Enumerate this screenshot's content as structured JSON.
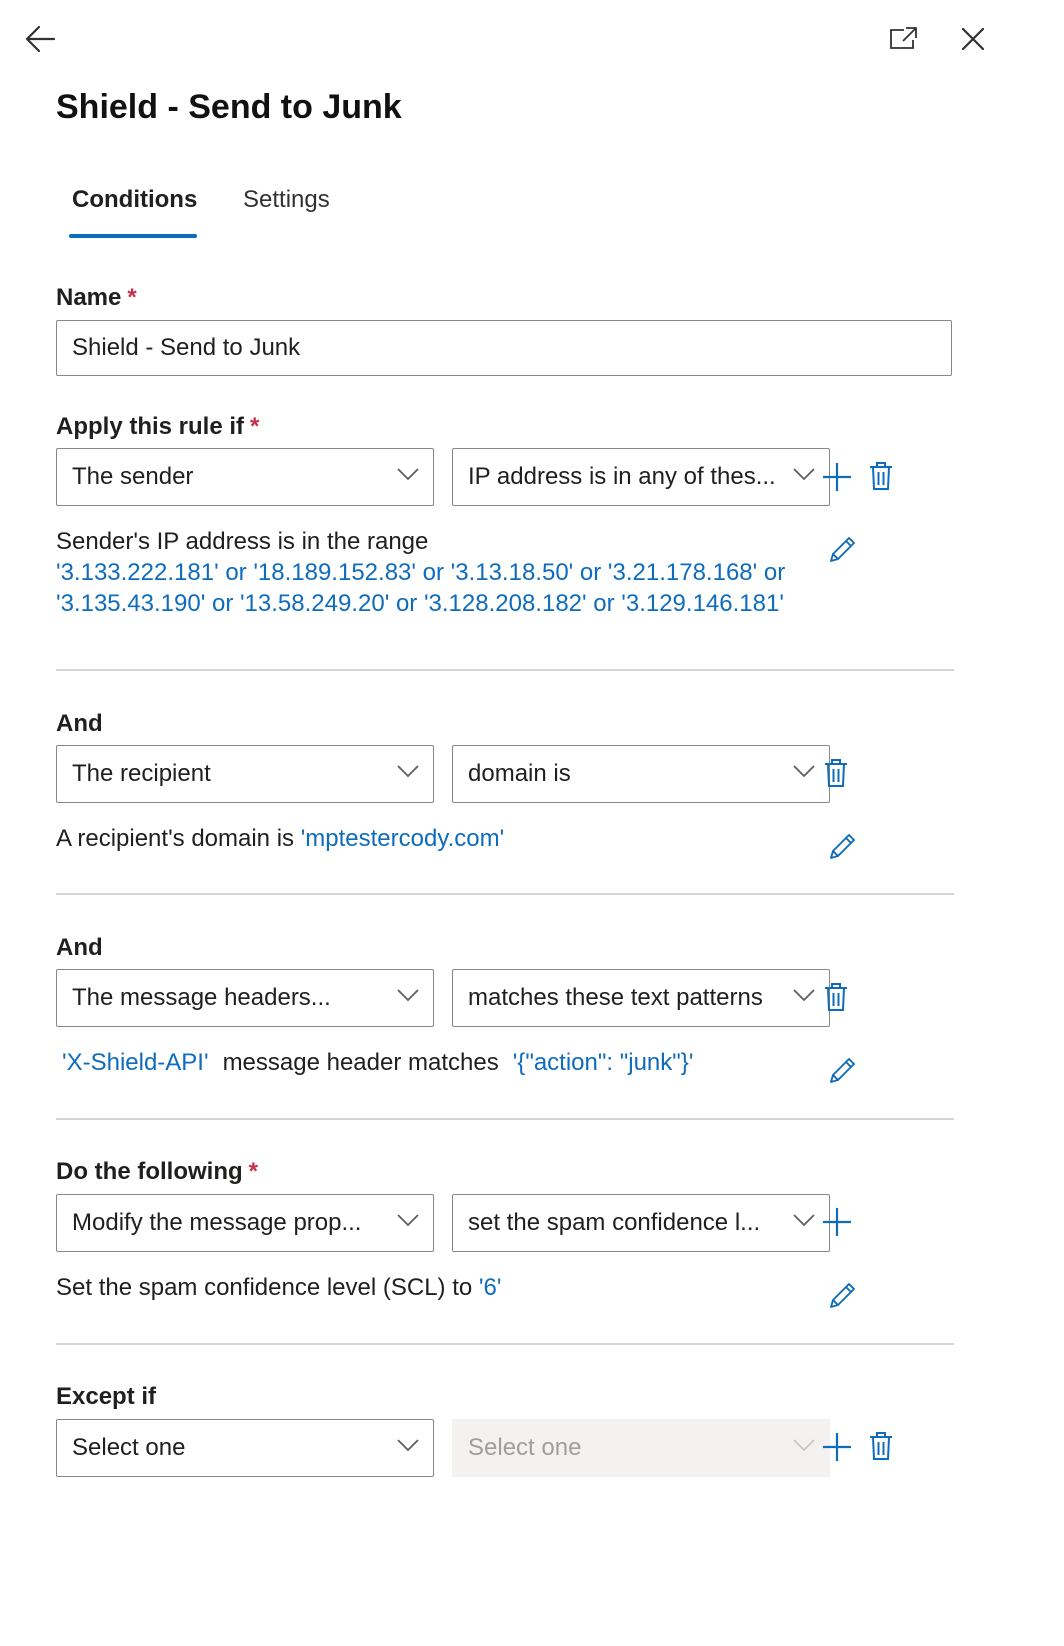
{
  "panel": {
    "back_icon": "arrow-left-icon",
    "popout_icon": "open-in-new-window-icon",
    "close_icon": "close-icon",
    "title": "Shield - Send to Junk"
  },
  "tabs": [
    {
      "label": "Conditions",
      "active": true
    },
    {
      "label": "Settings",
      "active": false
    }
  ],
  "name_field": {
    "label": "Name",
    "required_mark": "*",
    "value": "Shield - Send to Junk"
  },
  "apply_rule": {
    "label": "Apply this rule if",
    "required_mark": "*",
    "condition": "The sender",
    "operator": "IP address is in any of thes...",
    "description_prefix": "Sender's IP address is in the range",
    "values_line1": "'3.133.222.181' or '18.189.152.83' or '3.13.18.50' or '3.21.178.168' or",
    "values_line2": "'3.135.43.190' or '13.58.249.20' or '3.128.208.182' or '3.129.146.181'"
  },
  "and_recipient": {
    "label": "And",
    "condition": "The recipient",
    "operator": "domain is",
    "description_prefix": "A recipient's domain is ",
    "value": "'mptestercody.com'"
  },
  "and_headers": {
    "label": "And",
    "condition": "The message headers...",
    "operator": "matches these text patterns",
    "header_name": "'X-Shield-API'",
    "description_middle": "message header matches",
    "pattern": "'{\"action\": \"junk\"}'"
  },
  "do_following": {
    "label": "Do the following",
    "required_mark": "*",
    "action": "Modify the message prop...",
    "operator": "set the spam confidence l...",
    "description_prefix": "Set the spam confidence level (SCL) to ",
    "value": "'6'"
  },
  "except_if": {
    "label": "Except if",
    "condition": "Select one",
    "operator": "Select one"
  },
  "colors": {
    "accent": "#0f6cbd",
    "required": "#c4314b",
    "text": "#201f1e",
    "border": "#8a8886",
    "divider": "#d6d6d6",
    "disabled_bg": "#f3f2f1"
  }
}
